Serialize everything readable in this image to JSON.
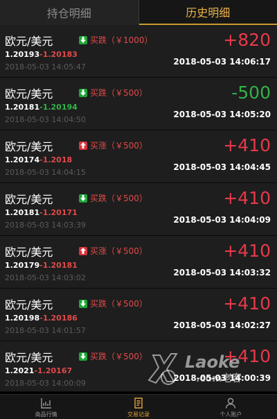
{
  "tabs": [
    {
      "label": "持仓明细",
      "active": false
    },
    {
      "label": "历史明细",
      "active": true
    }
  ],
  "records": [
    {
      "pair": "欧元/美元",
      "direction": "down",
      "action": "买跌（￥1000）",
      "open_price": "1.20193",
      "close_price": "1.20183",
      "close_color": "red",
      "open_time": "2018-05-03 14:05:47",
      "pnl": "+820",
      "pnl_color": "red",
      "close_time": "2018-05-03 14:06:17"
    },
    {
      "pair": "欧元/美元",
      "direction": "down",
      "action": "买跌（￥500）",
      "open_price": "1.20181",
      "close_price": "1.20194",
      "close_color": "green",
      "open_time": "2018-05-03 14:04:50",
      "pnl": "-500",
      "pnl_color": "green",
      "close_time": "2018-05-03 14:05:20"
    },
    {
      "pair": "欧元/美元",
      "direction": "up",
      "action": "买涨（￥500）",
      "open_price": "1.20174",
      "close_price": "1.2018",
      "close_color": "red",
      "open_time": "2018-05-03 14:04:15",
      "pnl": "+410",
      "pnl_color": "red",
      "close_time": "2018-05-03 14:04:45"
    },
    {
      "pair": "欧元/美元",
      "direction": "down",
      "action": "买跌（￥500）",
      "open_price": "1.20181",
      "close_price": "1.20171",
      "close_color": "red",
      "open_time": "2018-05-03 14:03:39",
      "pnl": "+410",
      "pnl_color": "red",
      "close_time": "2018-05-03 14:04:09"
    },
    {
      "pair": "欧元/美元",
      "direction": "up",
      "action": "买涨（￥500）",
      "open_price": "1.20179",
      "close_price": "1.20181",
      "close_color": "red",
      "open_time": "2018-05-03 14:03:02",
      "pnl": "+410",
      "pnl_color": "red",
      "close_time": "2018-05-03 14:03:32"
    },
    {
      "pair": "欧元/美元",
      "direction": "down",
      "action": "买跌（￥500）",
      "open_price": "1.20198",
      "close_price": "1.20186",
      "close_color": "red",
      "open_time": "2018-05-03 14:01:57",
      "pnl": "+410",
      "pnl_color": "red",
      "close_time": "2018-05-03 14:02:27"
    },
    {
      "pair": "欧元/美元",
      "direction": "down",
      "action": "买跌（￥500）",
      "open_price": "1.2021",
      "close_price": "1.20167",
      "close_color": "red",
      "open_time": "2018-05-03 14:00:09",
      "pnl": "+410",
      "pnl_color": "red",
      "close_time": "2018-05-03 14:00:39"
    }
  ],
  "price_separator": "-",
  "watermark": {
    "brand": "Laoke",
    "domain": ".com老客"
  },
  "bottom_nav": [
    {
      "label": "商品行情",
      "icon": "chart-icon",
      "active": false
    },
    {
      "label": "交易记录",
      "icon": "document-icon",
      "active": true
    },
    {
      "label": "个人账户",
      "icon": "user-icon",
      "active": false
    }
  ],
  "colors": {
    "gain": "#e8394a",
    "loss": "#32b24a",
    "accent": "#e0a43a"
  }
}
